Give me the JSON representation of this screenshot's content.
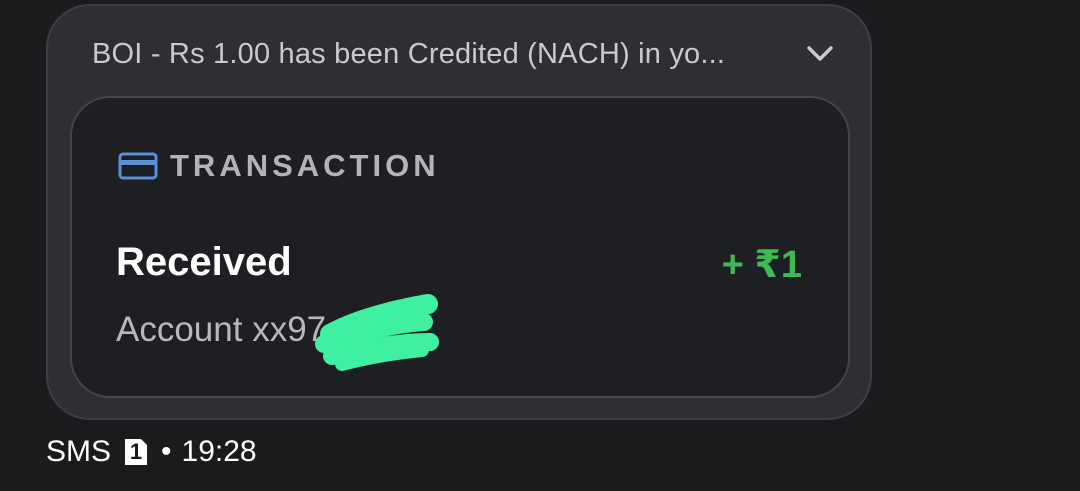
{
  "message": {
    "preview_text": "BOI -  Rs 1.00 has been Credited (NACH) in yo...",
    "expand_icon": "chevron-down-icon",
    "card": {
      "icon": "credit-card-icon",
      "category": "TRANSACTION",
      "title": "Received",
      "amount": "+ ₹1",
      "account": "Account xx97"
    },
    "meta": {
      "channel": "SMS",
      "sim_slot": "1",
      "separator": "•",
      "time": "19:28"
    }
  },
  "colors": {
    "background": "#1b1b1e",
    "bubble": "#2e2f34",
    "card": "#1e1f23",
    "amount_green": "#3fb855",
    "card_icon_blue": "#5b8fd6",
    "redaction": "#3ff0a0"
  }
}
